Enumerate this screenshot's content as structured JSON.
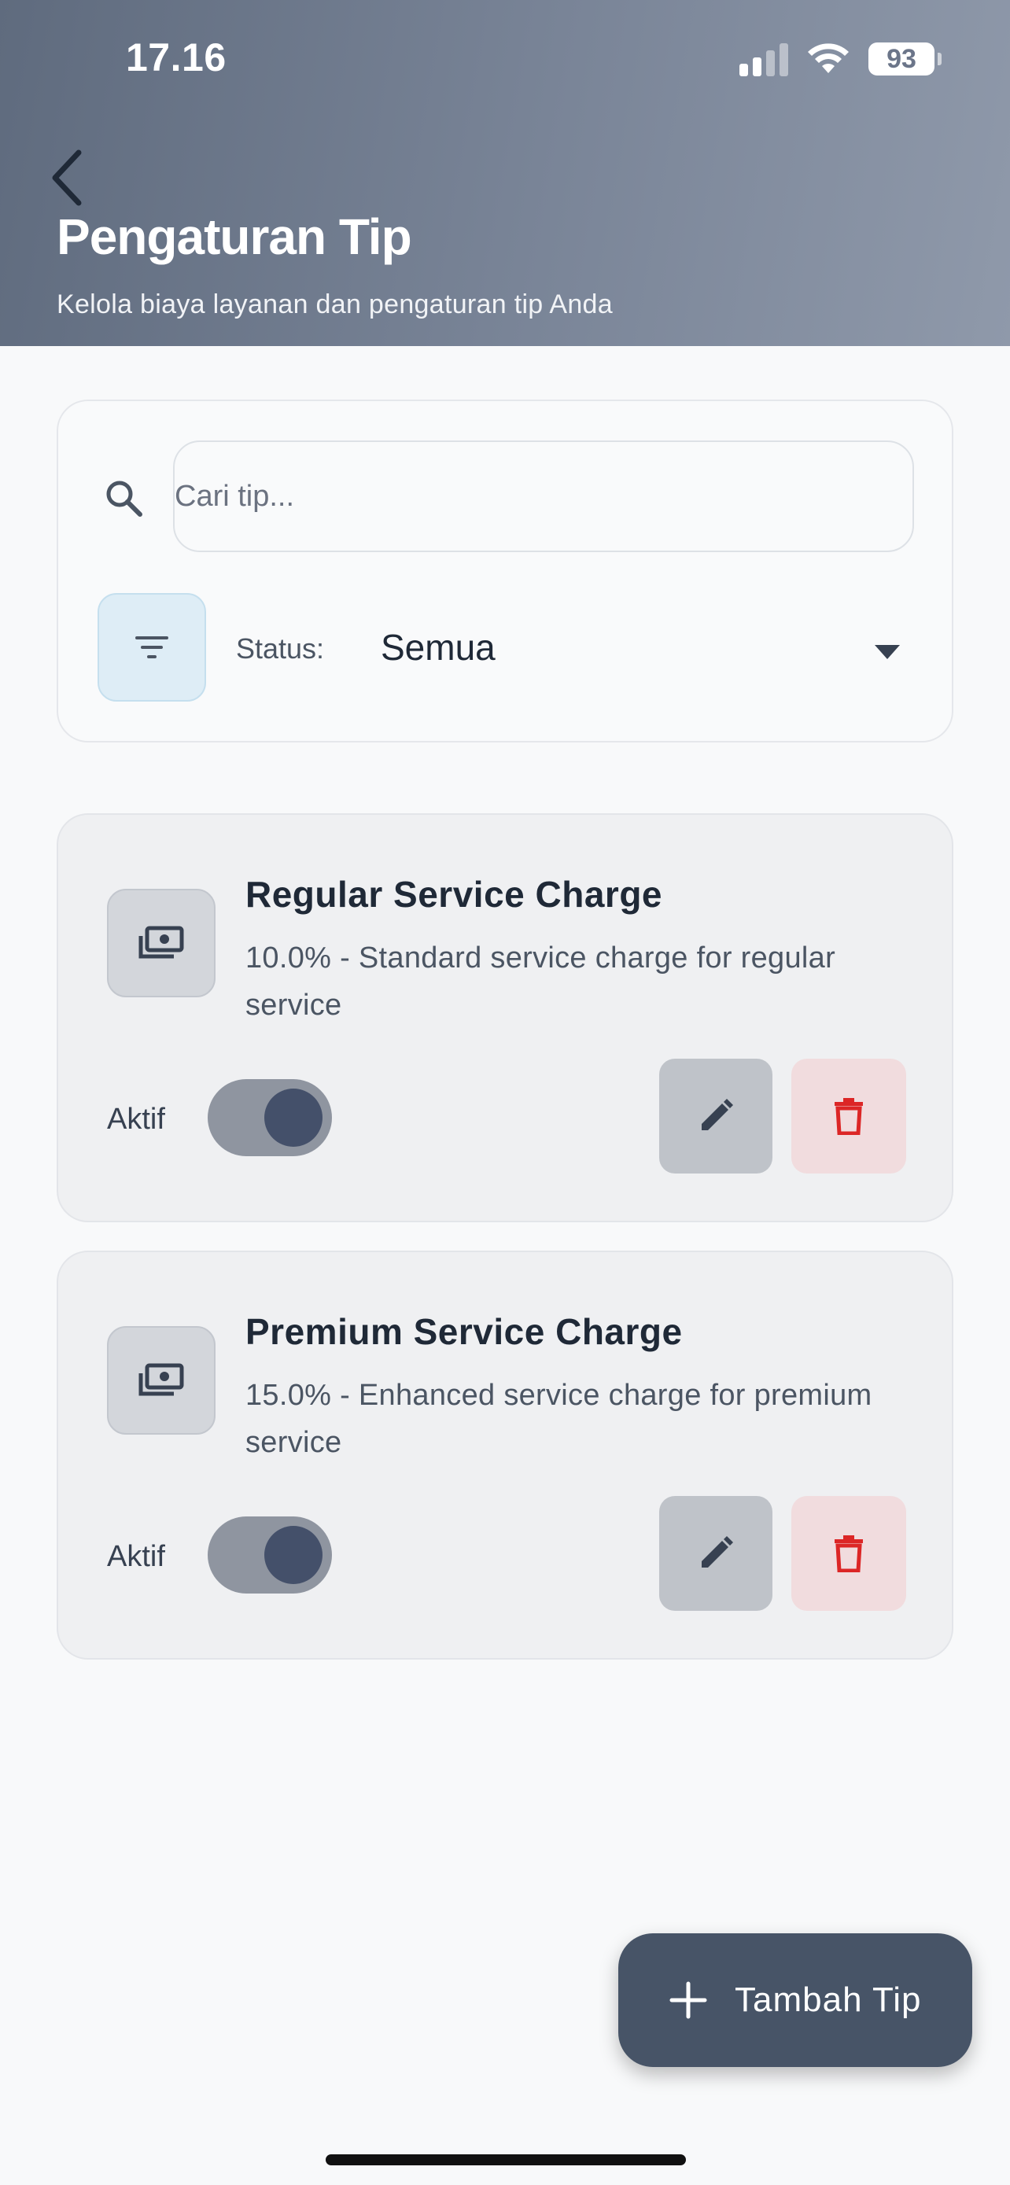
{
  "status_bar": {
    "time": "17.16",
    "battery": "93"
  },
  "header": {
    "title": "Pengaturan Tip",
    "subtitle": "Kelola biaya layanan dan pengaturan tip Anda"
  },
  "filter": {
    "search_placeholder": "Cari tip...",
    "status_label": "Status:",
    "status_value": "Semua"
  },
  "tips": [
    {
      "title": "Regular Service Charge",
      "description": "10.0% - Standard service charge for regular service",
      "status_label": "Aktif",
      "active": true
    },
    {
      "title": "Premium Service Charge",
      "description": "15.0% - Enhanced service charge for premium service",
      "status_label": "Aktif",
      "active": true
    }
  ],
  "fab": {
    "label": "Tambah Tip"
  },
  "colors": {
    "accent": "#475467",
    "delete": "#dc2626",
    "filter_bg": "#deedf6"
  },
  "icons": {
    "back": "chevron-left-icon",
    "search": "search-icon",
    "filter": "filter-icon",
    "dropdown": "caret-down-icon",
    "tip": "money-icon",
    "edit": "pencil-icon",
    "delete": "trash-icon",
    "add": "plus-icon"
  }
}
